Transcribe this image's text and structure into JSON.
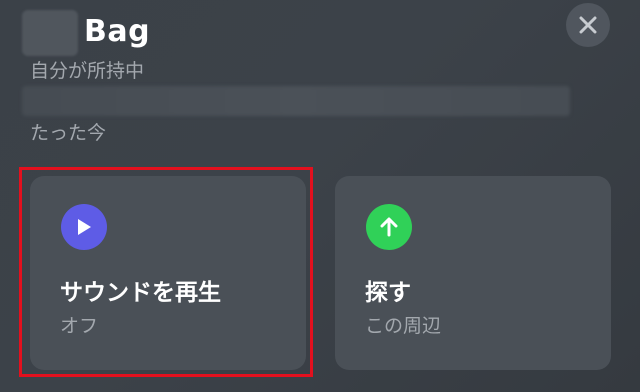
{
  "header": {
    "title": "Bag",
    "subtitle": "自分が所持中",
    "timestamp": "たった今"
  },
  "actions": [
    {
      "label": "サウンドを再生",
      "status": "オフ",
      "icon": "play-icon",
      "icon_color": "#5e5ce6"
    },
    {
      "label": "探す",
      "status": "この周辺",
      "icon": "arrow-up-icon",
      "icon_color": "#30d158"
    }
  ],
  "colors": {
    "highlight": "#e3101e",
    "card_bg": "#4a5057"
  }
}
